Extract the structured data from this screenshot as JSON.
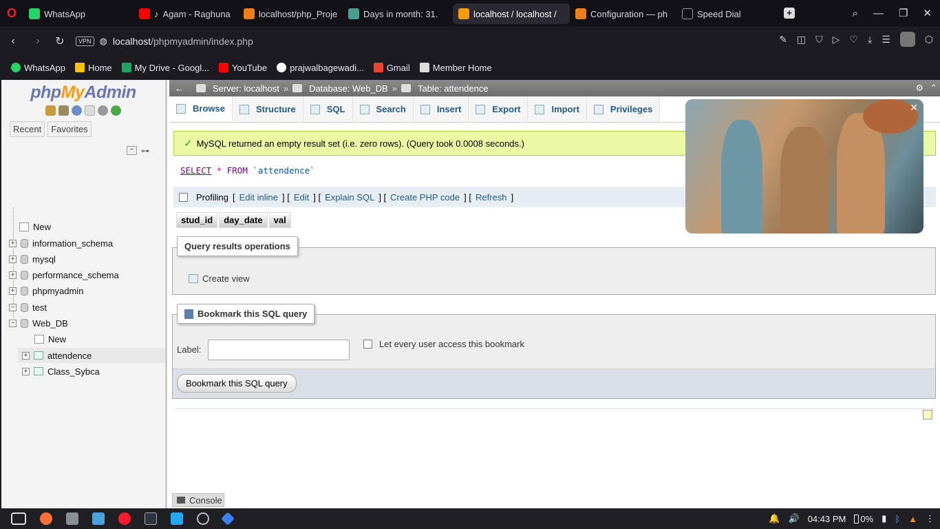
{
  "browser": {
    "tabs": [
      {
        "label": "WhatsApp",
        "color": "#25d366",
        "active": false
      },
      {
        "label": "Agam - Raghuna",
        "color": "#ff0000",
        "active": false
      },
      {
        "label": "localhost/php_Proje",
        "color": "#f07e16",
        "active": false
      },
      {
        "label": "Days in month: 31.",
        "color": "#4a9e8e",
        "active": false
      },
      {
        "label": "localhost / localhost /",
        "color": "#f89c0e",
        "active": true
      },
      {
        "label": "Configuration — ph",
        "color": "#f07e16",
        "active": false
      },
      {
        "label": "Speed Dial",
        "color": "#999999",
        "active": false
      }
    ],
    "vpn_label": "VPN",
    "url_host": "localhost",
    "url_path": "/phpmyadmin/index.php",
    "bookmarks": [
      {
        "label": "WhatsApp",
        "color": "#25d366"
      },
      {
        "label": "Home",
        "color": "#f4c20d"
      },
      {
        "label": "My Drive - Googl...",
        "color": "#1fa463"
      },
      {
        "label": "YouTube",
        "color": "#ff0000"
      },
      {
        "label": "prajwalbagewadi...",
        "color": "#ffffff"
      },
      {
        "label": "Gmail",
        "color": "#ea4335"
      },
      {
        "label": "Member Home",
        "color": "#dddddd"
      }
    ]
  },
  "sidebar": {
    "logo_php": "php",
    "logo_my": "My",
    "logo_admin": "Admin",
    "tab_recent": "Recent",
    "tab_favorites": "Favorites",
    "tree": [
      {
        "label": "New",
        "kind": "new"
      },
      {
        "label": "information_schema",
        "kind": "db"
      },
      {
        "label": "mysql",
        "kind": "db"
      },
      {
        "label": "performance_schema",
        "kind": "db"
      },
      {
        "label": "phpmyadmin",
        "kind": "db"
      },
      {
        "label": "test",
        "kind": "db"
      },
      {
        "label": "Web_DB",
        "kind": "db"
      },
      {
        "label": "New",
        "kind": "new"
      },
      {
        "label": "attendence",
        "kind": "table"
      },
      {
        "label": "Class_Sybca",
        "kind": "table"
      }
    ]
  },
  "breadcrumb": {
    "server": "Server: localhost",
    "database": "Database: Web_DB",
    "table": "Table: attendence",
    "sep": "»"
  },
  "tabs": [
    "Browse",
    "Structure",
    "SQL",
    "Search",
    "Insert",
    "Export",
    "Import",
    "Privileges"
  ],
  "message": "MySQL returned an empty result set (i.e. zero rows). (Query took 0.0008 seconds.)",
  "sql": {
    "select": "SELECT",
    "star": "*",
    "from": "FROM",
    "table": "`attendence`"
  },
  "profiling": {
    "label": "Profiling",
    "links": [
      "Edit inline",
      "Edit",
      "Explain SQL",
      "Create PHP code",
      "Refresh"
    ]
  },
  "columns": [
    "stud_id",
    "day_date",
    "val"
  ],
  "ops": {
    "legend": "Query results operations",
    "create_view": "Create view"
  },
  "bookmark": {
    "legend": "Bookmark this SQL query",
    "label": "Label:",
    "share": "Let every user access this bookmark",
    "button": "Bookmark this SQL query"
  },
  "console": "Console",
  "tray": {
    "time": "04:43 PM",
    "battery": "0%"
  }
}
